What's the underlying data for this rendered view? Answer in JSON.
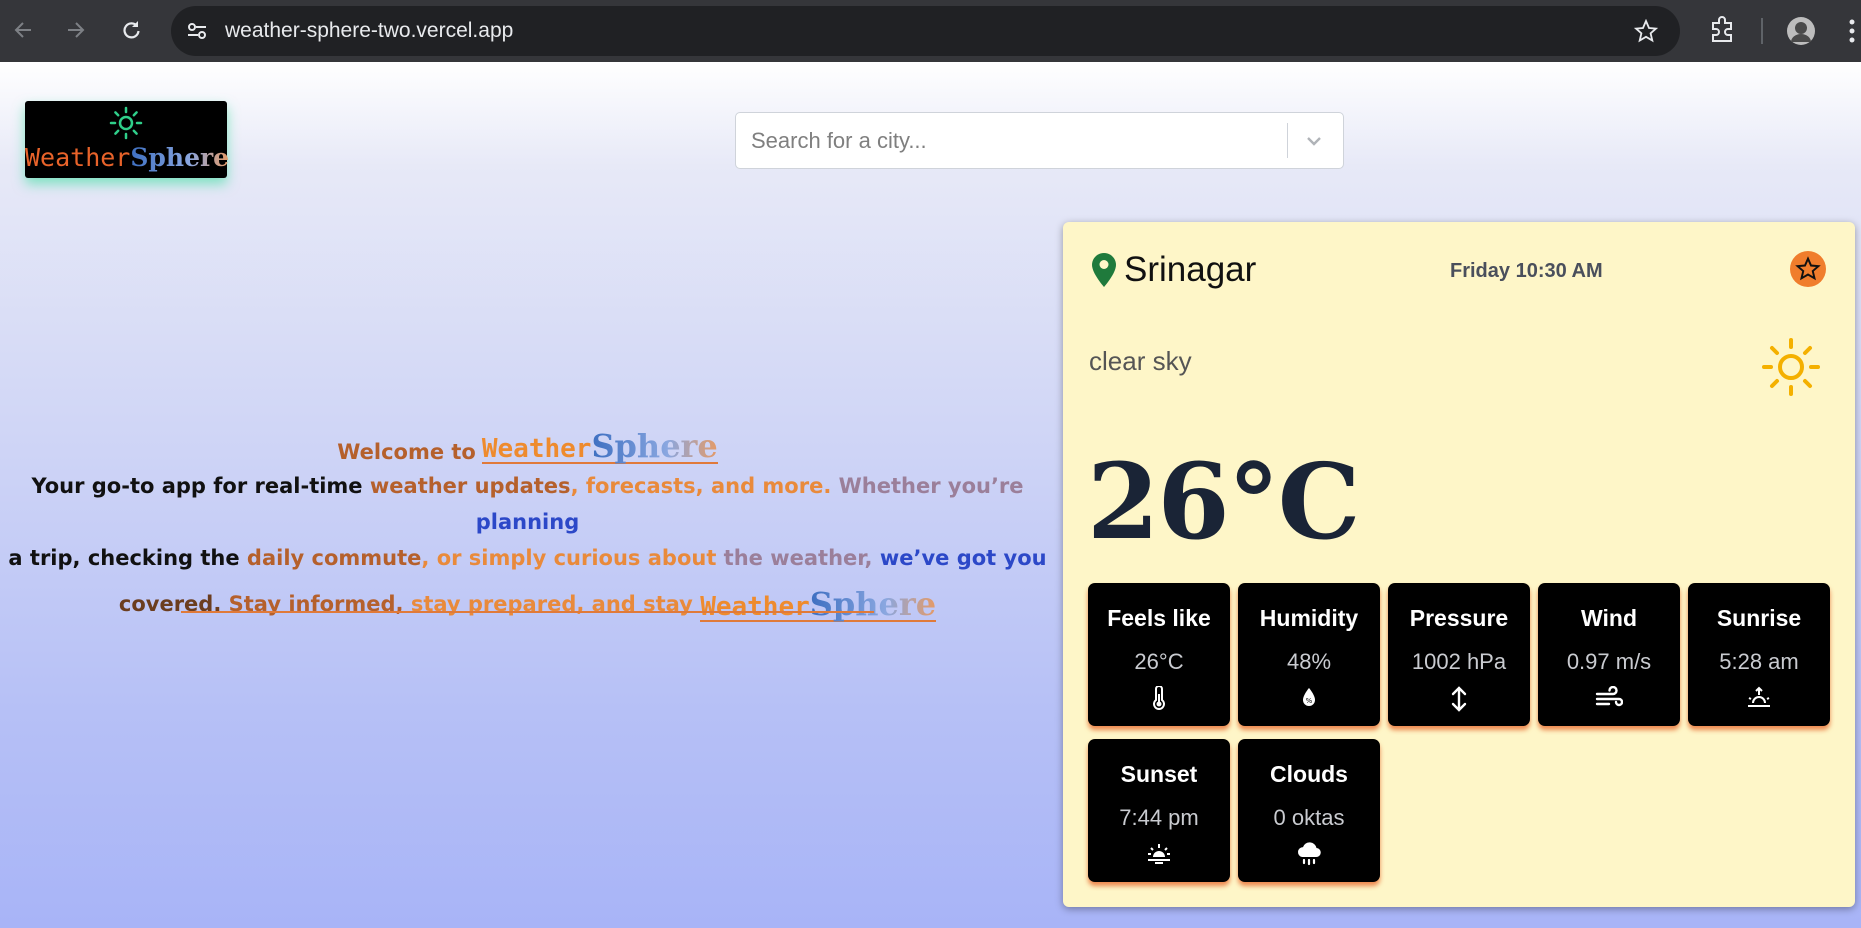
{
  "browser": {
    "url": "weather-sphere-two.vercel.app",
    "icons": [
      "back-icon",
      "forward-icon",
      "reload-icon",
      "site-info-icon",
      "bookmark-star-icon",
      "extensions-icon",
      "profile-avatar",
      "menu-icon"
    ]
  },
  "header": {
    "logo": {
      "part1": "Weather",
      "part2": "Sphere",
      "icon": "sun-icon"
    },
    "search": {
      "placeholder": "Search for a city..."
    }
  },
  "welcome": {
    "prefix": "Welcome to",
    "brand_part1": "Weather",
    "brand_part2": "Sphere",
    "d1": "Your go-to app for real-time ",
    "d2": "weather updates",
    "d3": ", forecasts, and more. ",
    "d4": "Whether you’re ",
    "d5": "planning",
    "line2_a": "a trip, checking the ",
    "line2_b": "daily commute",
    "line2_c": ", or simply curious about ",
    "line2_d": "the weather, ",
    "line2_e": "we’ve got you",
    "line3_a": "covered. ",
    "line3_b": "Stay informed, ",
    "line3_c": "stay prepared, and stay "
  },
  "weather": {
    "city": "Srinagar",
    "datetime": "Friday 10:30 AM",
    "description": "clear sky",
    "temperature": "26°C",
    "icons": {
      "location": "map-pin-icon",
      "favorite": "star-icon",
      "condition": "sun-icon"
    },
    "tiles": [
      {
        "title": "Feels like",
        "value": "26°C",
        "icon": "thermometer-icon"
      },
      {
        "title": "Humidity",
        "value": "48%",
        "icon": "droplet-icon"
      },
      {
        "title": "Pressure",
        "value": "1002 hPa",
        "icon": "arrows-vertical-icon"
      },
      {
        "title": "Wind",
        "value": "0.97 m/s",
        "icon": "wind-icon"
      },
      {
        "title": "Sunrise",
        "value": "5:28 am",
        "icon": "sunrise-icon"
      },
      {
        "title": "Sunset",
        "value": "7:44 pm",
        "icon": "sunset-icon"
      },
      {
        "title": "Clouds",
        "value": "0 oktas",
        "icon": "cloud-rain-icon"
      }
    ]
  },
  "colors": {
    "card_bg": "#fef6c8",
    "accent_orange": "#f07d2c",
    "tile_bg": "#000000",
    "pin_green": "#1f7a3c"
  }
}
